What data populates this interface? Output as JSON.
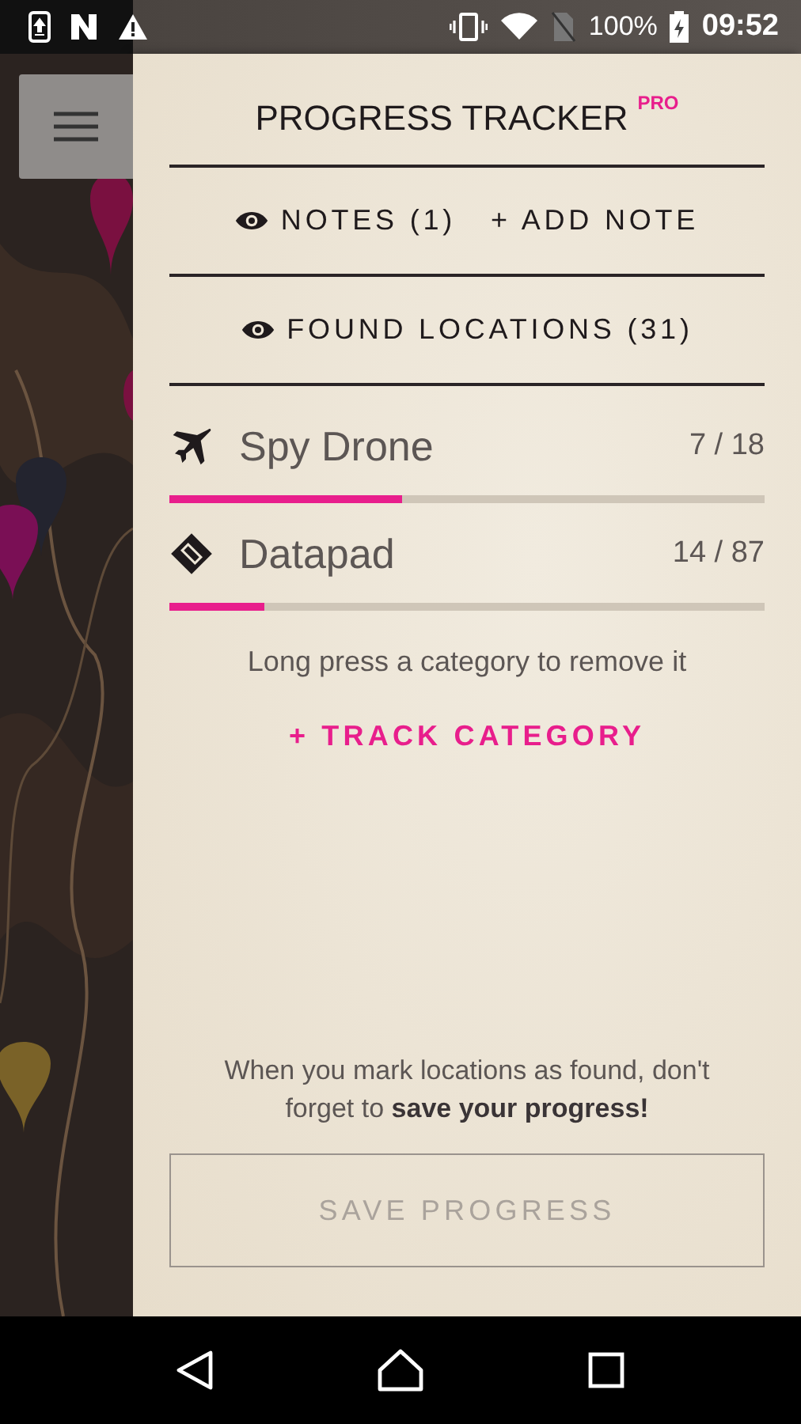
{
  "status_bar": {
    "battery": "100%",
    "time": "09:52"
  },
  "panel": {
    "title": "PROGRESS TRACKER",
    "badge": "PRO",
    "notes_button": "NOTES (1)",
    "add_note_button": "+ ADD NOTE",
    "found_button": "FOUND LOCATIONS (31)",
    "categories": [
      {
        "kind": "plane",
        "name": "Spy Drone",
        "count": "7 / 18",
        "level": 0.39
      },
      {
        "kind": "diamond",
        "name": "Datapad",
        "count": "14 / 87",
        "level": 0.16
      }
    ],
    "hint": "Long press a category to remove it",
    "track_button": "+ TRACK CATEGORY",
    "save_note": "When you mark locations as found, don't forget to **save your progress!**",
    "save_button": {
      "label": "SAVE PROGRESS",
      "disabled": true
    }
  }
}
